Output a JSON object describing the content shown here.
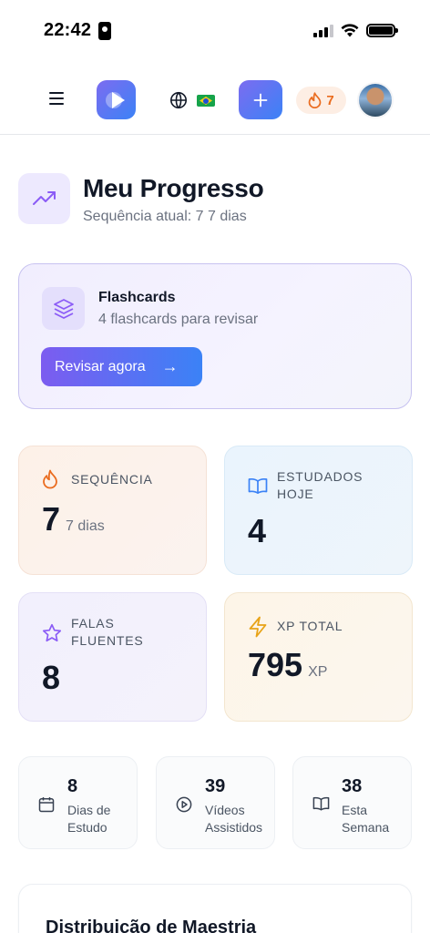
{
  "status_bar": {
    "time": "22:42"
  },
  "header": {
    "streak_count": "7",
    "colors": {
      "accent_start": "#7c6cf0",
      "accent_end": "#3b82f6",
      "streak": "#ea6c1f"
    }
  },
  "title": {
    "heading": "Meu Progresso",
    "subtitle": "Sequência atual: 7 7 dias"
  },
  "flashcards": {
    "title": "Flashcards",
    "subtitle": "4 flashcards para revisar",
    "button_label": "Revisar agora",
    "button_arrow": "→"
  },
  "stats": {
    "streak": {
      "label": "SEQUÊNCIA",
      "value": "7",
      "unit": "7 dias",
      "icon": "flame-icon"
    },
    "today": {
      "label": "ESTUDADOS HOJE",
      "value": "4",
      "icon": "book-open-icon"
    },
    "fluent": {
      "label": "FALAS FLUENTES",
      "value": "8",
      "icon": "star-icon"
    },
    "xp": {
      "label": "XP TOTAL",
      "value": "795",
      "unit": "XP",
      "icon": "zap-icon"
    }
  },
  "mini_stats": [
    {
      "value": "8",
      "label": "Dias de Estudo",
      "icon": "calendar-icon"
    },
    {
      "value": "39",
      "label": "Vídeos Assistidos",
      "icon": "play-circle-icon"
    },
    {
      "value": "38",
      "label": "Esta Semana",
      "icon": "book-icon"
    }
  ],
  "mastery": {
    "title": "Distribuição de Maestria"
  }
}
